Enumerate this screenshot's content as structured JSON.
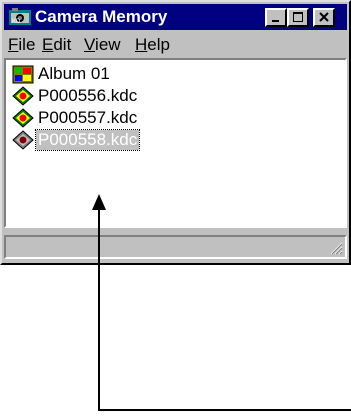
{
  "window": {
    "title": "Camera Memory"
  },
  "menu": {
    "file": {
      "key": "F",
      "rest": "ile"
    },
    "edit": {
      "key": "E",
      "rest": "dit"
    },
    "view": {
      "key": "V",
      "rest": "iew"
    },
    "help": {
      "key": "H",
      "rest": "elp"
    }
  },
  "list": {
    "items": [
      {
        "label": "Album  01",
        "icon": "album-icon"
      },
      {
        "label": "P000556.kdc",
        "icon": "image-file-icon"
      },
      {
        "label": "P000557.kdc",
        "icon": "image-file-icon"
      },
      {
        "label": "P000558.kdc",
        "icon": "image-file-icon",
        "selected": true
      }
    ]
  },
  "colors": {
    "title_bar": "#000080",
    "window_face": "#c0c0c0",
    "selection": "#c0c0c0"
  }
}
